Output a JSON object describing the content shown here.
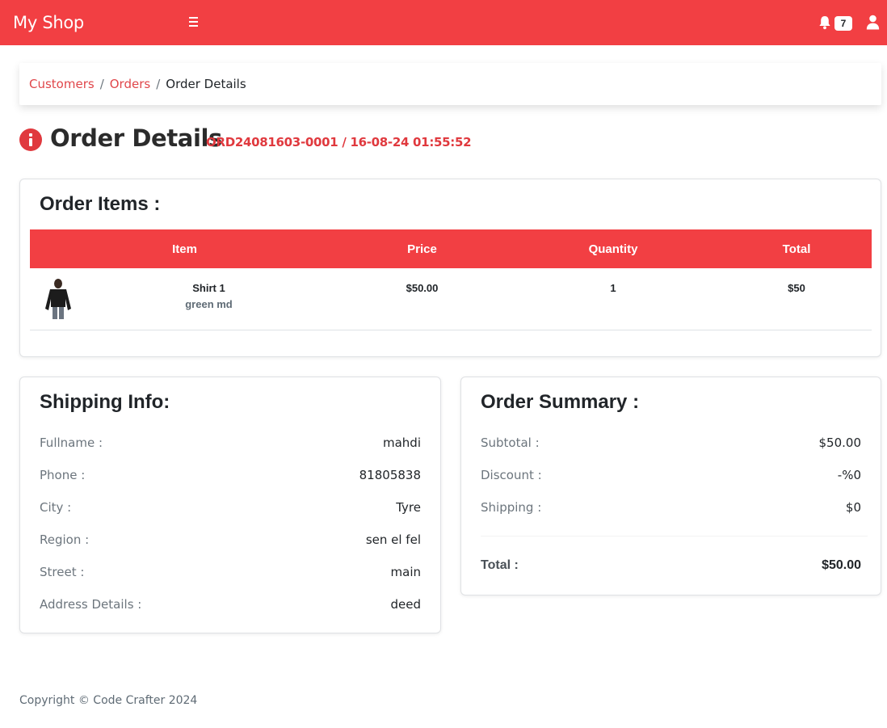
{
  "app": {
    "brand": "My Shop",
    "notification_count": "7"
  },
  "colors": {
    "accent": "#f23f43",
    "link": "#e0464a",
    "order_ref": "#e0393e"
  },
  "icons": {
    "menu": "hamburger-icon",
    "notifications": "bell-icon",
    "account": "user-icon",
    "info": "info-circle-icon"
  },
  "breadcrumb": {
    "customers": "Customers",
    "orders": "Orders",
    "current": "Order Details",
    "separator": "/"
  },
  "page": {
    "title": "Order Details",
    "order_ref": "ORD24081603-0001 / 16-08-24 01:55:52"
  },
  "order_items": {
    "title": "Order Items :",
    "columns": [
      "Item",
      "Price",
      "Quantity",
      "Total"
    ],
    "rows": [
      {
        "name": "Shirt 1",
        "variant": "green md",
        "price": "$50.00",
        "quantity": "1",
        "total": "$50"
      }
    ]
  },
  "shipping": {
    "title": "Shipping Info:",
    "fields": [
      {
        "label": "Fullname :",
        "value": "mahdi"
      },
      {
        "label": "Phone :",
        "value": "81805838"
      },
      {
        "label": "City :",
        "value": "Tyre"
      },
      {
        "label": "Region :",
        "value": "sen el fel"
      },
      {
        "label": "Street :",
        "value": "main"
      },
      {
        "label": "Address Details :",
        "value": "deed"
      }
    ]
  },
  "summary": {
    "title": "Order Summary :",
    "fields": [
      {
        "label": "Subtotal :",
        "value": "$50.00"
      },
      {
        "label": "Discount :",
        "value": "-%0"
      },
      {
        "label": "Shipping :",
        "value": "$0"
      }
    ],
    "total_label": "Total :",
    "total_value": "$50.00"
  },
  "footer": {
    "copyright": "Copyright © Code Crafter 2024"
  }
}
